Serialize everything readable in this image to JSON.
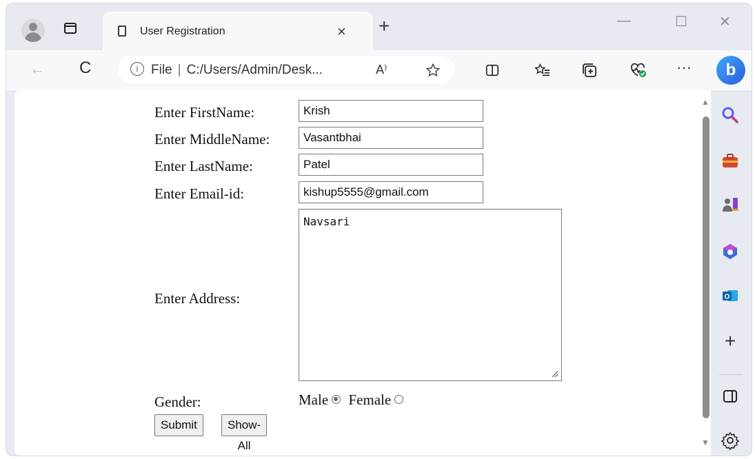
{
  "browser": {
    "tab_title": "User Registration",
    "tab_close": "×",
    "new_tab": "+",
    "window_controls": {
      "minimize": "—",
      "maximize": "☐",
      "close": "✕"
    },
    "nav": {
      "back": "←",
      "refresh": "C"
    },
    "address": {
      "info": "i",
      "scheme": "File",
      "separator": "|",
      "path": "C:/Users/Admin/Desk...",
      "read_aloud": "A⁾"
    },
    "toolbar_icons": [
      "favorites-star-icon",
      "split-screen-icon",
      "favorites-list-icon",
      "collections-icon",
      "browser-essentials-icon",
      "more-icon"
    ],
    "more_label": "···",
    "copilot": "b"
  },
  "form": {
    "firstname_label": "Enter FirstName:",
    "firstname_value": "Krish",
    "middlename_label": "Enter MiddleName:",
    "middlename_value": "Vasantbhai",
    "lastname_label": "Enter LastName:",
    "lastname_value": "Patel",
    "email_label": "Enter Email-id:",
    "email_value": "kishup5555@gmail.com",
    "address_label": "Enter Address:",
    "address_value": "Navsari",
    "gender_label": "Gender:",
    "gender_male": "Male",
    "gender_female": "Female",
    "gender_selected": "Male",
    "submit_label": "Submit",
    "showall_label": "Show-All"
  },
  "sidebar": {
    "items": [
      "search-icon",
      "tools-icon",
      "games-icon",
      "office-icon",
      "outlook-icon",
      "add-icon",
      "sidebar-panel-icon",
      "settings-icon"
    ],
    "add_label": "+"
  }
}
